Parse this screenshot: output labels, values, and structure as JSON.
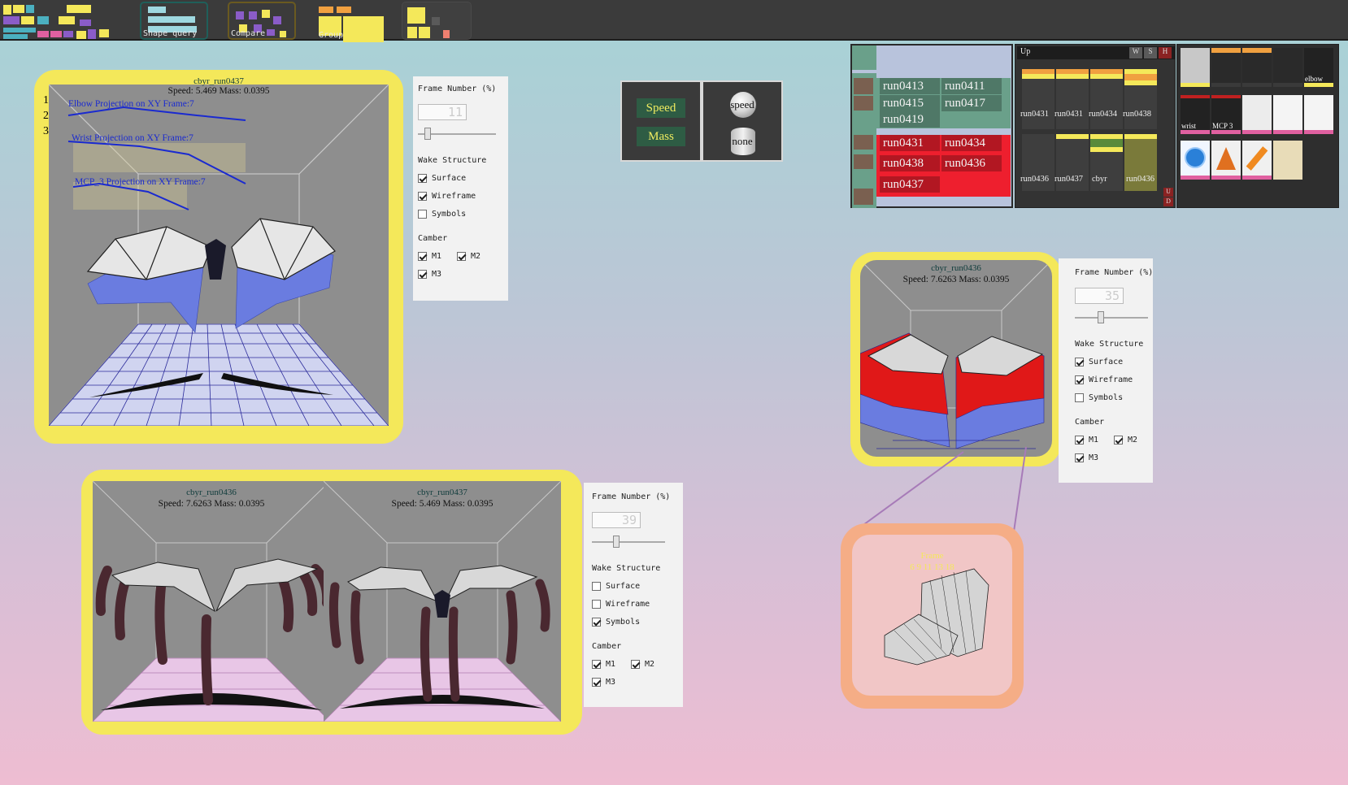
{
  "toolbar": {
    "buttons": [
      {
        "label": ""
      },
      {
        "label": "Shape query"
      },
      {
        "label": "Compare"
      },
      {
        "label": "Group"
      },
      {
        "label": ""
      }
    ]
  },
  "main_view": {
    "title": "cbyr_run0437",
    "info": "Speed: 5.469 Mass: 0.0395",
    "row_numbers": [
      "1",
      "2",
      "3"
    ],
    "projections": [
      "Elbow Projection on XY Frame:7",
      "Wrist Projection on XY Frame:7",
      "MCP_3 Projection on XY Frame:7"
    ]
  },
  "panel_main": {
    "frame_label": "Frame Number (%)",
    "frame_value": "11",
    "frame_pct": 0.12,
    "wake_label": "Wake Structure",
    "surface": {
      "label": "Surface",
      "checked": true
    },
    "wireframe": {
      "label": "Wireframe",
      "checked": true
    },
    "symbols": {
      "label": "Symbols",
      "checked": false
    },
    "camber_label": "Camber",
    "m1": {
      "label": "M1",
      "checked": true
    },
    "m2": {
      "label": "M2",
      "checked": true
    },
    "m3": {
      "label": "M3",
      "checked": true
    }
  },
  "speed_mass": {
    "speed_label": "Speed",
    "mass_label": "Mass",
    "sphere_label": "speed",
    "cylinder_label": "none"
  },
  "runs": {
    "group1": [
      "run0413",
      "run0411",
      "run0415",
      "run0417",
      "run0419"
    ],
    "group2": [
      "run0431",
      "run0434",
      "run0438",
      "run0436",
      "run0437"
    ]
  },
  "up_panel": {
    "title": "Up",
    "buttons": [
      "W",
      "S",
      "H"
    ],
    "side_buttons": [
      "U",
      "D"
    ],
    "row1": [
      "run0431",
      "run0431",
      "run0434",
      "run0438"
    ],
    "row2": [
      "run0436",
      "run0437",
      "cbyr",
      "run0436"
    ]
  },
  "icons": {
    "labels": [
      "elbow",
      "wrist",
      "MCP 3"
    ]
  },
  "right_view": {
    "title": "cbyr_run0436",
    "info": "Speed: 7.6263 Mass: 0.0395"
  },
  "panel_right": {
    "frame_label": "Frame Number (%)",
    "frame_value": "35",
    "frame_pct": 0.35,
    "wake_label": "Wake Structure",
    "surface": {
      "label": "Surface",
      "checked": true
    },
    "wireframe": {
      "label": "Wireframe",
      "checked": true
    },
    "symbols": {
      "label": "Symbols",
      "checked": false
    },
    "camber_label": "Camber",
    "m1": {
      "label": "M1",
      "checked": true
    },
    "m2": {
      "label": "M2",
      "checked": true
    },
    "m3": {
      "label": "M3",
      "checked": true
    }
  },
  "compare_views": [
    {
      "title": "cbyr_run0436",
      "info": "Speed: 7.6263 Mass: 0.0395"
    },
    {
      "title": "cbyr_run0437",
      "info": "Speed: 5.469 Mass: 0.0395"
    }
  ],
  "panel_bottom": {
    "frame_label": "Frame Number (%)",
    "frame_value": "39",
    "frame_pct": 0.33,
    "wake_label": "Wake Structure",
    "surface": {
      "label": "Surface",
      "checked": false
    },
    "wireframe": {
      "label": "Wireframe",
      "checked": false
    },
    "symbols": {
      "label": "Symbols",
      "checked": true
    },
    "camber_label": "Camber",
    "m1": {
      "label": "M1",
      "checked": true
    },
    "m2": {
      "label": "M2",
      "checked": true
    },
    "m3": {
      "label": "M3",
      "checked": true
    }
  },
  "frame_tile": {
    "label": "Frame",
    "frames": "6 9 11 13 18"
  },
  "colors": {
    "highlight": "#f4e85a",
    "accent": "#f0ec60",
    "selected_run": "#ee1f2e",
    "frame_tile": "#f5ad86"
  }
}
